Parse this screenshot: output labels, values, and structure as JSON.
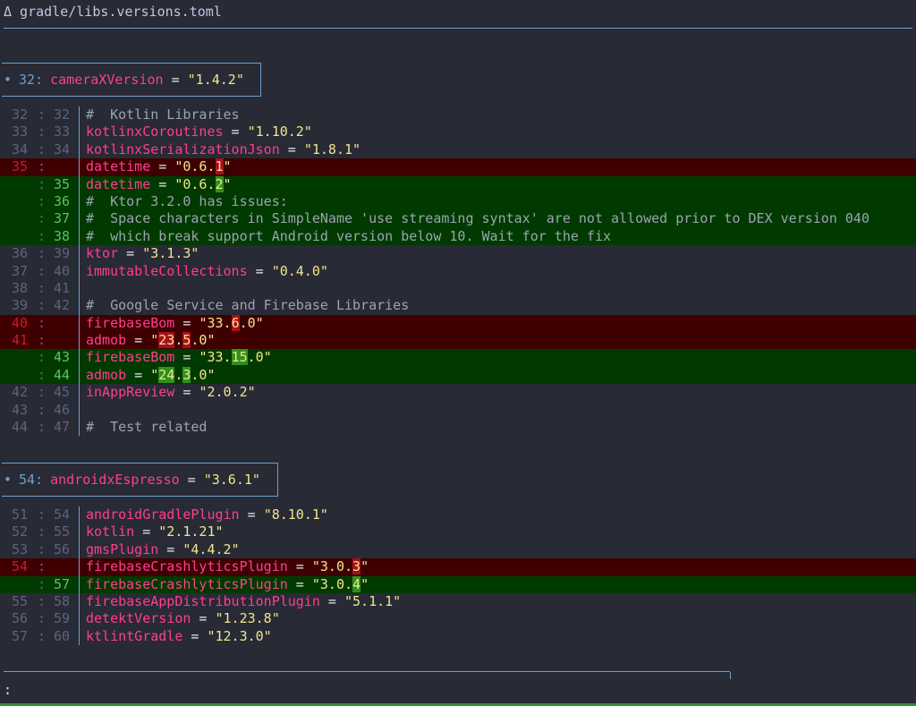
{
  "header": {
    "file_path": "Δ gradle/libs.versions.toml"
  },
  "hunks": [
    {
      "line_number": "32",
      "name": "cameraXVersion",
      "value": "\"1.4.2\""
    },
    {
      "line_number": "54",
      "name": "androidxEspresso",
      "value": "\"3.6.1\""
    }
  ],
  "prompt": ":",
  "colors": {
    "background": "#282a36",
    "key": "#ff3f8e",
    "string": "#f1e68b",
    "comment": "#9ca3b0",
    "removed_row": "#3f0001",
    "added_row": "#003a00",
    "accent": "#6fa0cc"
  },
  "lines_hunk1": [
    {
      "type": "context",
      "old": "32",
      "new": "32",
      "comment": "#  Kotlin Libraries"
    },
    {
      "type": "context",
      "old": "33",
      "new": "33",
      "key": "kotlinxCoroutines",
      "value": "\"1.10.2\""
    },
    {
      "type": "context",
      "old": "34",
      "new": "34",
      "key": "kotlinxSerializationJson",
      "value": "\"1.8.1\""
    },
    {
      "type": "removed",
      "old": "35",
      "new": "",
      "key": "datetime",
      "value_parts": [
        "\"0.6.",
        "1",
        "\""
      ]
    },
    {
      "type": "added",
      "old": "",
      "new": "35",
      "key": "datetime",
      "value_parts": [
        "\"0.6.",
        "2",
        "\""
      ]
    },
    {
      "type": "added",
      "old": "",
      "new": "36",
      "comment": "#  Ktor 3.2.0 has issues:"
    },
    {
      "type": "added",
      "old": "",
      "new": "37",
      "comment": "#  Space characters in SimpleName 'use streaming syntax' are not allowed prior to DEX version 040"
    },
    {
      "type": "added",
      "old": "",
      "new": "38",
      "comment": "#  which break support Android version below 10. Wait for the fix"
    },
    {
      "type": "context",
      "old": "36",
      "new": "39",
      "key": "ktor",
      "value": "\"3.1.3\""
    },
    {
      "type": "context",
      "old": "37",
      "new": "40",
      "key": "immutableCollections",
      "value": "\"0.4.0\""
    },
    {
      "type": "context",
      "old": "38",
      "new": "41"
    },
    {
      "type": "context",
      "old": "39",
      "new": "42",
      "comment": "#  Google Service and Firebase Libraries"
    },
    {
      "type": "removed",
      "old": "40",
      "new": "",
      "key": "firebaseBom",
      "value_parts": [
        "\"33.",
        "6",
        ".0\""
      ]
    },
    {
      "type": "removed",
      "old": "41",
      "new": "",
      "key": "admob",
      "value_parts": [
        "\"",
        "23",
        ".",
        "5",
        ".0\""
      ]
    },
    {
      "type": "added",
      "old": "",
      "new": "43",
      "key": "firebaseBom",
      "value_parts": [
        "\"33.",
        "15",
        ".0\""
      ]
    },
    {
      "type": "added",
      "old": "",
      "new": "44",
      "key": "admob",
      "value_parts": [
        "\"",
        "24",
        ".",
        "3",
        ".0\""
      ]
    },
    {
      "type": "context",
      "old": "42",
      "new": "45",
      "key": "inAppReview",
      "value": "\"2.0.2\""
    },
    {
      "type": "context",
      "old": "43",
      "new": "46"
    },
    {
      "type": "context",
      "old": "44",
      "new": "47",
      "comment": "#  Test related"
    }
  ],
  "lines_hunk2": [
    {
      "type": "context",
      "old": "51",
      "new": "54",
      "key": "androidGradlePlugin",
      "value": "\"8.10.1\""
    },
    {
      "type": "context",
      "old": "52",
      "new": "55",
      "key": "kotlin",
      "value": "\"2.1.21\""
    },
    {
      "type": "context",
      "old": "53",
      "new": "56",
      "key": "gmsPlugin",
      "value": "\"4.4.2\""
    },
    {
      "type": "removed",
      "old": "54",
      "new": "",
      "key": "firebaseCrashlyticsPlugin",
      "value_parts": [
        "\"3.0.",
        "3",
        "\""
      ]
    },
    {
      "type": "added",
      "old": "",
      "new": "57",
      "key": "firebaseCrashlyticsPlugin",
      "value_parts": [
        "\"3.0.",
        "4",
        "\""
      ]
    },
    {
      "type": "context",
      "old": "55",
      "new": "58",
      "key": "firebaseAppDistributionPlugin",
      "value": "\"5.1.1\""
    },
    {
      "type": "context",
      "old": "56",
      "new": "59",
      "key": "detektVersion",
      "value": "\"1.23.8\""
    },
    {
      "type": "context",
      "old": "57",
      "new": "60",
      "key": "ktlintGradle",
      "value": "\"12.3.0\""
    }
  ]
}
